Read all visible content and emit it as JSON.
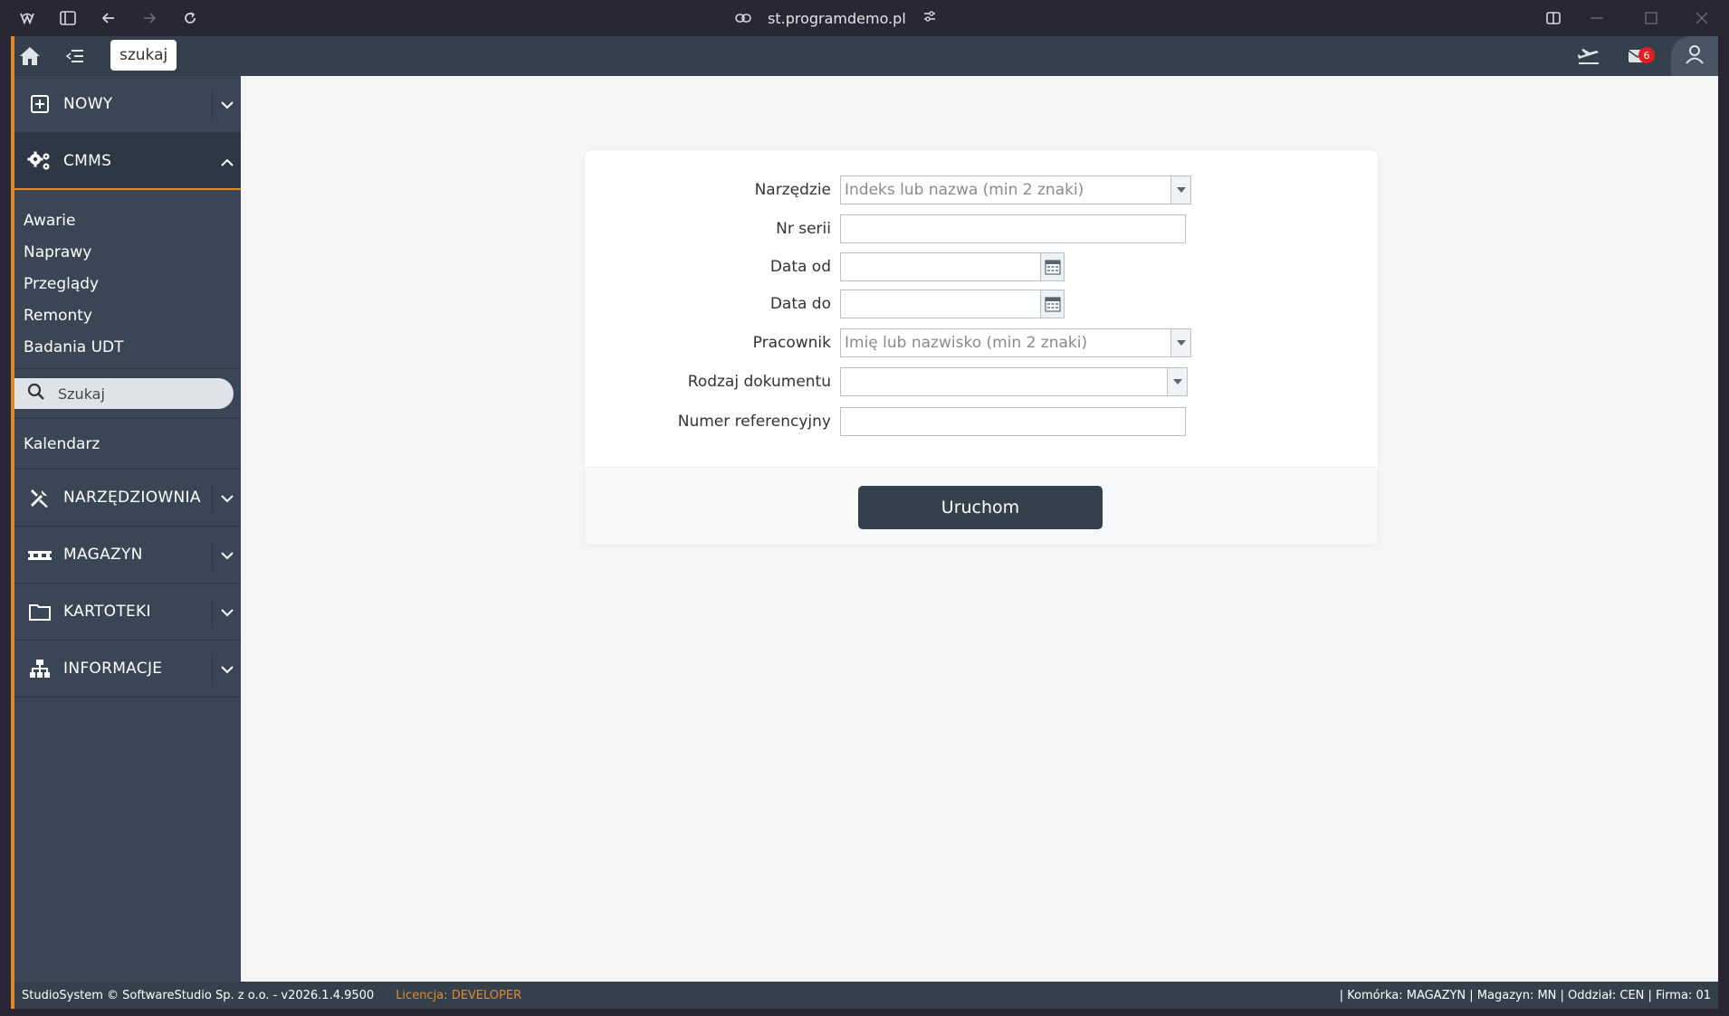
{
  "browser": {
    "url": "st.programdemo.pl"
  },
  "topbar": {
    "search_tab_label": "szukaj",
    "mail_count": "6"
  },
  "sidebar": {
    "sections": [
      {
        "label": "NOWY",
        "icon": "plus-square-icon"
      },
      {
        "label": "CMMS",
        "icon": "gears-icon"
      }
    ],
    "cmms_items": [
      "Awarie",
      "Naprawy",
      "Przeglądy",
      "Remonty",
      "Badania UDT"
    ],
    "search_placeholder": "Szukaj",
    "calendar_label": "Kalendarz",
    "bottom_sections": [
      {
        "label": "NARZĘDZIOWNIA",
        "icon": "tools-icon"
      },
      {
        "label": "MAGAZYN",
        "icon": "pallet-icon"
      },
      {
        "label": "KARTOTEKI",
        "icon": "folder-icon"
      },
      {
        "label": "INFORMACJE",
        "icon": "sitemap-icon"
      }
    ]
  },
  "form": {
    "tool_label": "Narzędzie",
    "tool_placeholder": "Indeks lub nazwa (min 2 znaki)",
    "serial_label": "Nr serii",
    "serial_value": "",
    "date_from_label": "Data od",
    "date_from_value": "",
    "date_to_label": "Data do",
    "date_to_value": "",
    "employee_label": "Pracownik",
    "employee_placeholder": "Imię lub nazwisko (min 2 znaki)",
    "doc_type_label": "Rodzaj dokumentu",
    "doc_type_value": "",
    "ref_label": "Numer referencyjny",
    "ref_value": "",
    "run_label": "Uruchom"
  },
  "footer": {
    "copyright": "StudioSystem © SoftwareStudio Sp. z o.o. - v2026.1.4.9500",
    "license_prefix": "Licencja:",
    "license_value": "DEVELOPER",
    "context": "| Komórka: MAGAZYN | Magazyn: MN | Oddział: CEN | Firma: 01"
  },
  "colors": {
    "accent": "#e08a2a",
    "sidebar": "#3a4655",
    "topbar": "#35404d",
    "badge": "#e02020"
  }
}
